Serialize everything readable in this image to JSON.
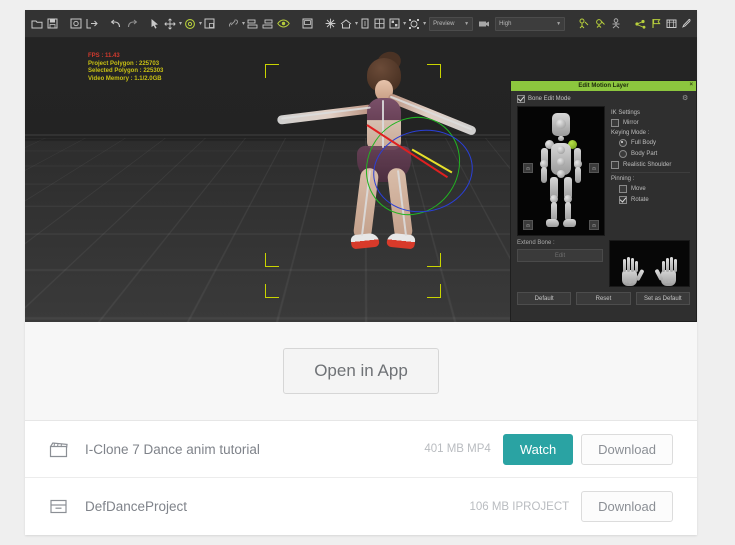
{
  "app": {
    "toolbar": {
      "icons": [
        {
          "name": "open-file-icon",
          "glyph": "open"
        },
        {
          "name": "save-icon",
          "glyph": "save"
        },
        {
          "name": "render-image-icon",
          "glyph": "image"
        },
        {
          "name": "export-icon",
          "glyph": "export"
        },
        {
          "name": "undo-icon",
          "glyph": "undo"
        },
        {
          "name": "redo-icon",
          "glyph": "redo"
        },
        {
          "name": "select-tool-icon",
          "glyph": "cursor"
        },
        {
          "name": "move-tool-icon",
          "glyph": "move"
        },
        {
          "name": "rotate-tool-icon",
          "glyph": "rotate"
        },
        {
          "name": "scale-tool-icon",
          "glyph": "scale"
        },
        {
          "name": "link-icon",
          "glyph": "link"
        },
        {
          "name": "align-left-icon",
          "glyph": "align1"
        },
        {
          "name": "align-right-icon",
          "glyph": "align2"
        },
        {
          "name": "eye-icon",
          "glyph": "eye"
        },
        {
          "name": "camera-view-icon",
          "glyph": "camera"
        },
        {
          "name": "light-icon",
          "glyph": "light"
        },
        {
          "name": "home-icon",
          "glyph": "home"
        },
        {
          "name": "frame-object-icon",
          "glyph": "frame"
        },
        {
          "name": "grid-icon",
          "glyph": "grid"
        },
        {
          "name": "viewport-layout-icon",
          "glyph": "layout"
        },
        {
          "name": "gizmo-toggle-icon",
          "glyph": "gizmo"
        },
        {
          "name": "film-icon",
          "glyph": "film"
        },
        {
          "name": "motion-puppet-icon",
          "glyph": "puppet"
        },
        {
          "name": "face-puppet-icon",
          "glyph": "face"
        },
        {
          "name": "motion-layer-icon",
          "glyph": "layer"
        },
        {
          "name": "edit-motion-icon",
          "glyph": "editmotion"
        },
        {
          "name": "flag-icon",
          "glyph": "flag"
        },
        {
          "name": "timeline-icon",
          "glyph": "timeline"
        },
        {
          "name": "eyedropper-icon",
          "glyph": "picker"
        }
      ],
      "quality_dropdown": "Preview",
      "render_dropdown": "High"
    },
    "viewport": {
      "stats": {
        "fps": "FPS : 11.43",
        "project_polygon": "Project Polygon : 225703",
        "selected_polygon": "Selected Polygon : 225303",
        "video_memory": "Video Memory : 1.1/2.0GB"
      }
    },
    "panel": {
      "title": "Edit Motion Layer",
      "close_label": "×",
      "bone_edit_mode": "Bone Edit Mode",
      "ik_settings_label": "IK Settings",
      "mirror_label": "Mirror",
      "keying_mode_label": "Keying Mode :",
      "keying_full_body": "Full Body",
      "keying_body_part": "Body Part",
      "realistic_shoulder": "Realistic Shoulder",
      "pinning_label": "Pinning :",
      "pinning_move": "Move",
      "pinning_rotate": "Rotate",
      "extend_bone_label": "Extend Bone :",
      "extend_bone_button": "Edit",
      "hand_right": "Right",
      "hand_left": "Left",
      "btn_default": "Default",
      "btn_reset": "Reset",
      "btn_set_as_default": "Set as Default"
    }
  },
  "open_in_app": {
    "label": "Open in App"
  },
  "files": [
    {
      "icon": "clapperboard-icon",
      "name": "I-Clone 7 Dance anim tutorial",
      "meta": "401 MB MP4",
      "watch_label": "Watch",
      "download_label": "Download",
      "has_watch": true
    },
    {
      "icon": "archive-box-icon",
      "name": "DefDanceProject",
      "meta": "106 MB IPROJECT",
      "download_label": "Download",
      "has_watch": false
    }
  ],
  "colors": {
    "accent_teal": "#2aa3a3",
    "panel_green": "#8cc63e",
    "page_bg": "#efefef",
    "fps_red": "#d13a2e",
    "stats_yellow": "#c8c014"
  }
}
